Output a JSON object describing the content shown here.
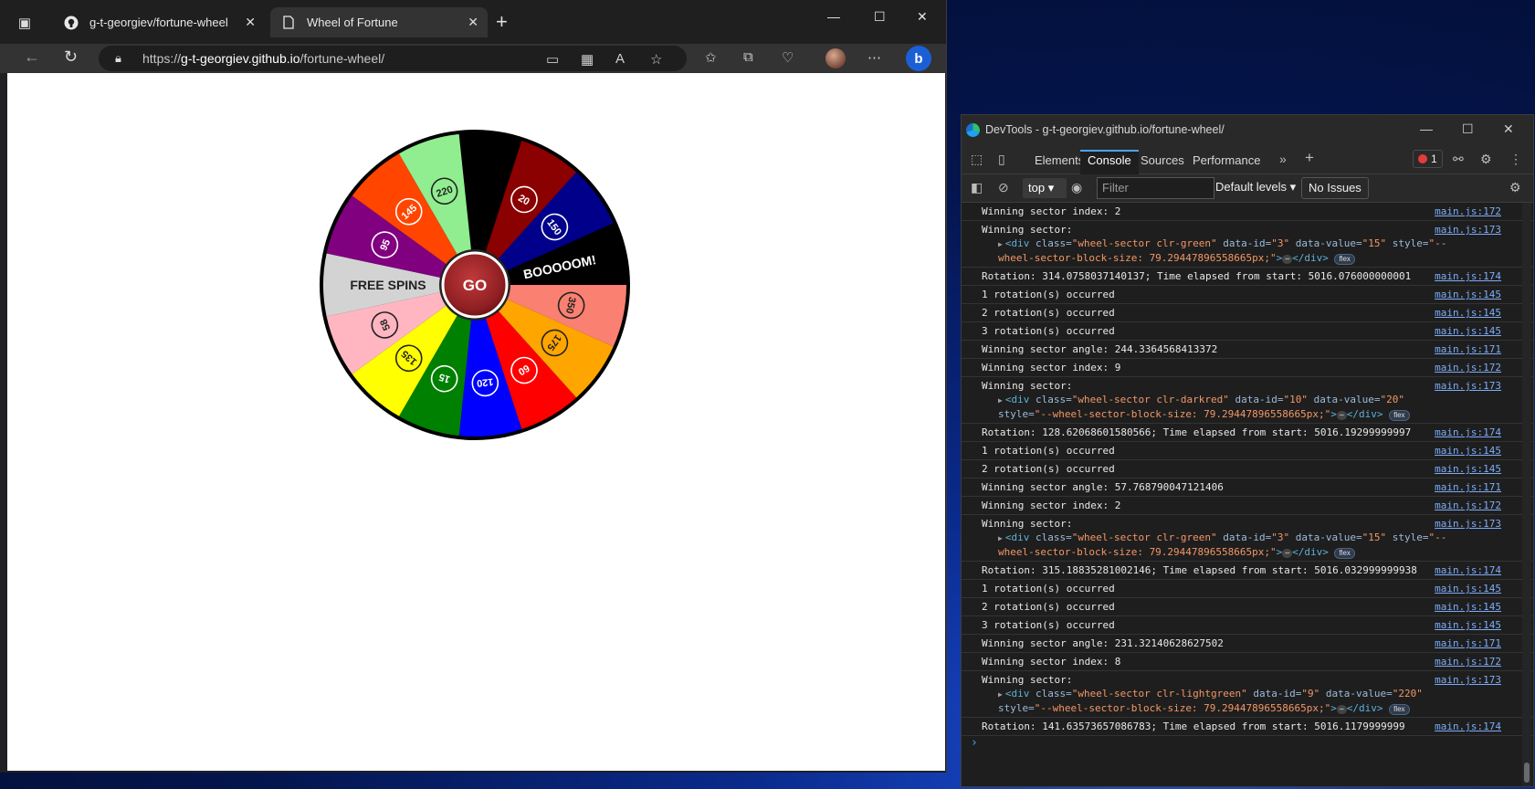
{
  "browser": {
    "tabs": [
      {
        "title": "g-t-georgiev/fortune-wheel",
        "icon": "github-icon"
      },
      {
        "title": "Wheel of Fortune",
        "icon": "page-icon"
      }
    ],
    "url_prefix": "https://",
    "url_host": "g-t-georgiev.github.io",
    "url_path": "/fortune-wheel/"
  },
  "wheel": {
    "center_label": "GO",
    "sectors": [
      {
        "label": "",
        "color": "#000000",
        "type": "blank"
      },
      {
        "label": "20",
        "color": "#8b0000",
        "type": "number"
      },
      {
        "label": "150",
        "color": "#00008b",
        "type": "number"
      },
      {
        "label": "BOOOOOM!",
        "color": "#000000",
        "type": "text"
      },
      {
        "label": "350",
        "color": "#fa8072",
        "type": "number"
      },
      {
        "label": "175",
        "color": "#ffa500",
        "type": "number"
      },
      {
        "label": "60",
        "color": "#ff0000",
        "type": "number"
      },
      {
        "label": "120",
        "color": "#0000ff",
        "type": "number"
      },
      {
        "label": "15",
        "color": "#008000",
        "type": "number"
      },
      {
        "label": "135",
        "color": "#ffff00",
        "type": "number"
      },
      {
        "label": "58",
        "color": "#ffb6c1",
        "type": "number"
      },
      {
        "label": "FREE SPINS",
        "color": "#d3d3d3",
        "type": "text"
      },
      {
        "label": "95",
        "color": "#800080",
        "type": "number"
      },
      {
        "label": "145",
        "color": "#ff4500",
        "type": "number"
      },
      {
        "label": "220",
        "color": "#90ee90",
        "type": "number"
      }
    ]
  },
  "devtools": {
    "title": "DevTools - g-t-georgiev.github.io/fortune-wheel/",
    "tabs": [
      "Elements",
      "Console",
      "Sources",
      "Performance"
    ],
    "error_count": "1",
    "context": "top",
    "filter_placeholder": "Filter",
    "levels": "Default levels",
    "issues": "No Issues",
    "logs": [
      {
        "msg": "Winning sector index: 2",
        "src": "main.js:172"
      },
      {
        "msg": "Winning sector:",
        "src": "main.js:173",
        "node": {
          "class": "wheel-sector clr-green",
          "id": "3",
          "value": "15",
          "style": "--wheel-sector-block-size: 79.29447896558665px;"
        }
      },
      {
        "msg": "Rotation: 314.0758037140137; Time elapsed from start: 5016.076000000001",
        "src": "main.js:174"
      },
      {
        "msg": "1 rotation(s) occurred",
        "src": "main.js:145"
      },
      {
        "msg": "2 rotation(s) occurred",
        "src": "main.js:145"
      },
      {
        "msg": "3 rotation(s) occurred",
        "src": "main.js:145"
      },
      {
        "msg": "Winning sector angle: 244.3364568413372",
        "src": "main.js:171"
      },
      {
        "msg": "Winning sector index: 9",
        "src": "main.js:172"
      },
      {
        "msg": "Winning sector:",
        "src": "main.js:173",
        "node": {
          "class": "wheel-sector clr-darkred",
          "id": "10",
          "value": "20",
          "style": "--wheel-sector-block-size: 79.29447896558665px;"
        }
      },
      {
        "msg": "Rotation: 128.62068601580566; Time elapsed from start: 5016.19299999997",
        "src": "main.js:174"
      },
      {
        "msg": "1 rotation(s) occurred",
        "src": "main.js:145"
      },
      {
        "msg": "2 rotation(s) occurred",
        "src": "main.js:145"
      },
      {
        "msg": "Winning sector angle: 57.768790047121406",
        "src": "main.js:171"
      },
      {
        "msg": "Winning sector index: 2",
        "src": "main.js:172"
      },
      {
        "msg": "Winning sector:",
        "src": "main.js:173",
        "node": {
          "class": "wheel-sector clr-green",
          "id": "3",
          "value": "15",
          "style": "--wheel-sector-block-size: 79.29447896558665px;"
        }
      },
      {
        "msg": "Rotation: 315.18835281002146; Time elapsed from start: 5016.032999999938",
        "src": "main.js:174"
      },
      {
        "msg": "1 rotation(s) occurred",
        "src": "main.js:145"
      },
      {
        "msg": "2 rotation(s) occurred",
        "src": "main.js:145"
      },
      {
        "msg": "3 rotation(s) occurred",
        "src": "main.js:145"
      },
      {
        "msg": "Winning sector angle: 231.32140628627502",
        "src": "main.js:171"
      },
      {
        "msg": "Winning sector index: 8",
        "src": "main.js:172"
      },
      {
        "msg": "Winning sector:",
        "src": "main.js:173",
        "node": {
          "class": "wheel-sector clr-lightgreen",
          "id": "9",
          "value": "220",
          "style": "--wheel-sector-block-size: 79.29447896558665px;"
        }
      },
      {
        "msg": "Rotation: 141.63573657086783; Time elapsed from start: 5016.1179999999",
        "src": "main.js:174"
      }
    ]
  }
}
